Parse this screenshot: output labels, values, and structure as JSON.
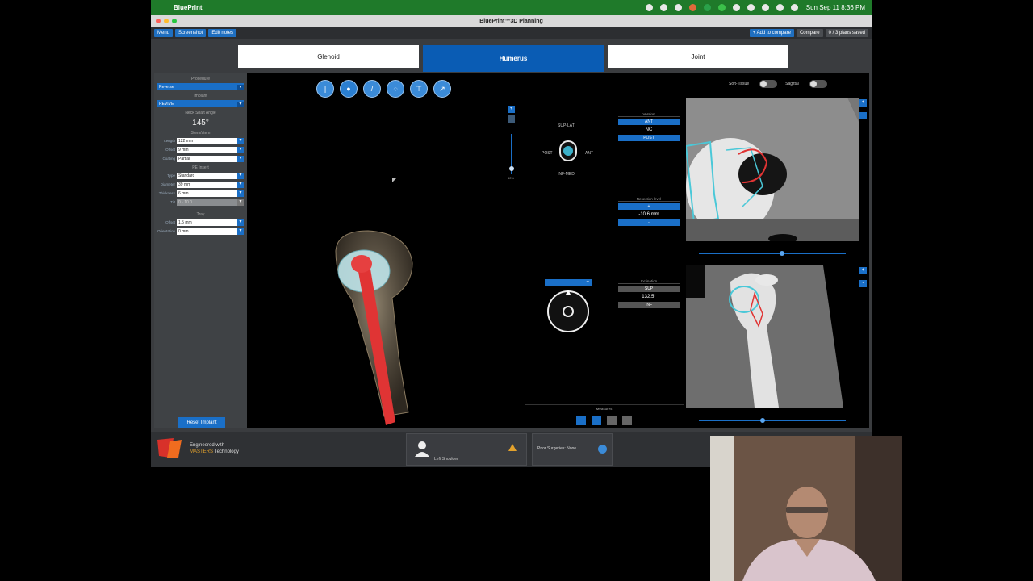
{
  "menubar": {
    "app_name": "BluePrint",
    "clock": "Sun Sep 11  8:36 PM"
  },
  "window": {
    "title": "BluePrint™3D Planning"
  },
  "toolbar": {
    "menu": "Menu",
    "screenshot": "Screenshot",
    "edit_notes": "Edit notes",
    "add_compare": "+ Add to compare",
    "compare": "Compare",
    "plans_saved": "0 / 3 plans saved"
  },
  "tabs": [
    {
      "label": "Glenoid"
    },
    {
      "label": "Humerus"
    },
    {
      "label": "Joint"
    }
  ],
  "left_panel": {
    "procedure_head": "Procedure",
    "procedure_value": "Reverse",
    "implant_head": "Implant",
    "implant_value": "REVIVE",
    "neck_shaft_head": "Neck Shaft Angle",
    "neck_shaft_value": "145°",
    "stem_head": "Stem/stem",
    "length_label": "Length",
    "length_value": "122 mm",
    "offset_label": "Offset",
    "offset_value": "9 mm",
    "coating_label": "Coating",
    "coating_value": "Partial",
    "pe_head": "PE Insert",
    "type_label": "Type",
    "type_value": "Standard",
    "diameter_label": "Diameter",
    "diameter_value": "39 mm",
    "thickness_label": "Thickness",
    "thickness_value": "6 mm",
    "tilt_label": "Tilt",
    "tilt_value": "0 - 10.0",
    "tray_head": "Tray",
    "tray_offset_label": "Offset",
    "tray_offset_value": "1.5 mm",
    "tray_pos_label": "Orientation",
    "tray_pos_value": "0 mm",
    "reset_button": "Reset Implant"
  },
  "viewport": {
    "slider_pct": "50%"
  },
  "mid_panel": {
    "sup_lat": "SUP-LAT",
    "inf_med": "INF-MED",
    "post": "POST",
    "ant": "ANT",
    "version_head": "Version",
    "ant_btn": "ANT",
    "version_value": "NC",
    "post_btn": "POST",
    "resection_head": "Resection level",
    "resection_up": "+",
    "resection_value": "-10.6 mm",
    "resection_down": "-",
    "inclination_head": "Inclination",
    "sup_btn": "SUP",
    "inclination_value": "132.5°",
    "inf_btn": "INF",
    "measure_head": "Measures"
  },
  "right_panel": {
    "soft_tissue": "Soft-Tissue",
    "sagittal": "Sagittal"
  },
  "footer": {
    "engineered": "Engineered with",
    "materialise": "MASTERS",
    "technology": "Technology",
    "patient_side": "Left Shoulder",
    "prior_surgeries": "Prior Surgeries: None"
  },
  "colors": {
    "accent": "#1a6fc7",
    "tab_active": "#0a5cb4",
    "menubar": "#1f7a2a"
  }
}
